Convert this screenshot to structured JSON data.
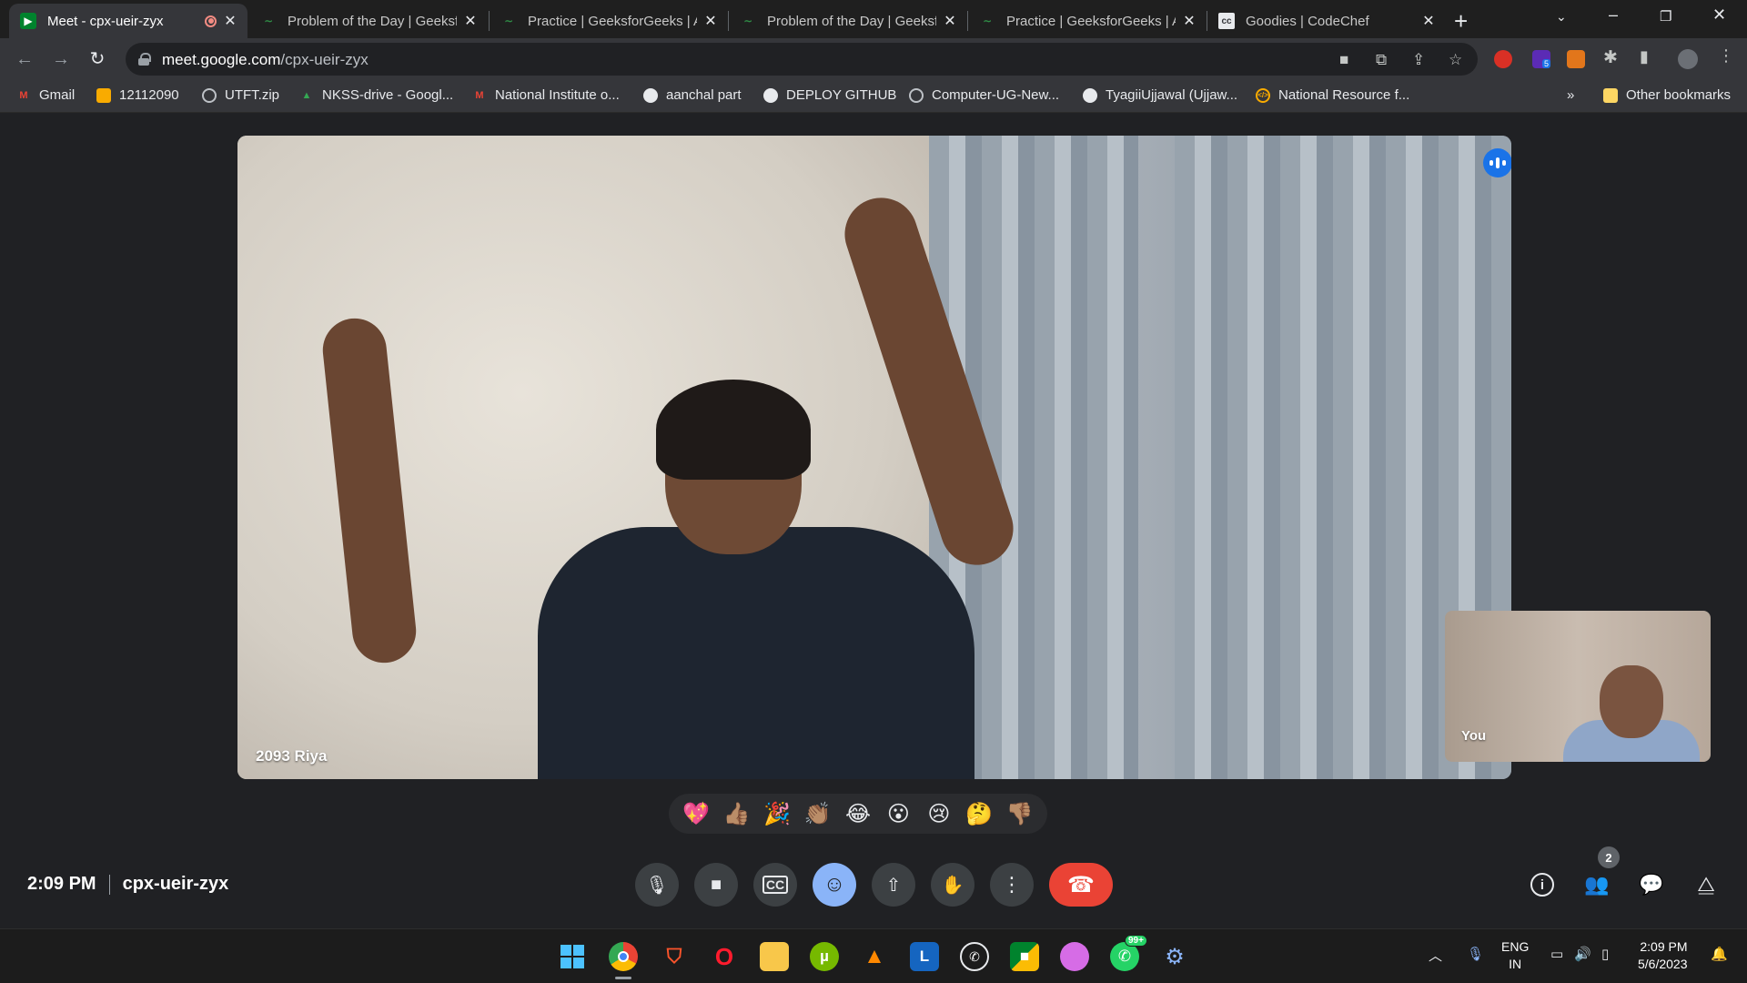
{
  "browser": {
    "tabs": [
      {
        "title": "Meet - cpx-ueir-zyx",
        "active": true,
        "recording": true
      },
      {
        "title": "Problem of the Day | GeeksforGeeks"
      },
      {
        "title": "Practice | GeeksforGeeks | A"
      },
      {
        "title": "Problem of the Day | GeeksforGeeks"
      },
      {
        "title": "Practice | GeeksforGeeks | A"
      },
      {
        "title": "Goodies | CodeChef"
      }
    ],
    "url_host": "meet.google.com",
    "url_path": "/cpx-ueir-zyx",
    "extension_badge": "5",
    "bookmarks": [
      {
        "label": "Gmail",
        "icon": "gmail-icon"
      },
      {
        "label": "12112090",
        "icon": "classroom-icon"
      },
      {
        "label": "UTFT.zip",
        "icon": "globe-icon"
      },
      {
        "label": "NKSS-drive - Googl...",
        "icon": "drive-icon"
      },
      {
        "label": "National Institute o...",
        "icon": "gmail-icon"
      },
      {
        "label": "aanchal part",
        "icon": "github-icon"
      },
      {
        "label": "DEPLOY GITHUB",
        "icon": "github-icon"
      },
      {
        "label": "Computer-UG-New...",
        "icon": "globe-icon"
      },
      {
        "label": "TyagiiUjjawal (Ujjaw...",
        "icon": "github-icon"
      },
      {
        "label": "National Resource f...",
        "icon": "code-icon"
      }
    ],
    "overflow_label": "»",
    "other_bookmarks": "Other bookmarks"
  },
  "meet": {
    "main_participant": "2093 Riya",
    "self_label": "You",
    "reactions": [
      "💖",
      "👍🏽",
      "🎉",
      "👏🏽",
      "😂",
      "😮",
      "😢",
      "🤔",
      "👎🏽"
    ],
    "time": "2:09 PM",
    "meeting_code": "cpx-ueir-zyx",
    "participant_count": "2"
  },
  "taskbar": {
    "lang_top": "ENG",
    "lang_bottom": "IN",
    "whatsapp_badge": "99+",
    "time": "2:09 PM",
    "date": "5/6/2023"
  },
  "colors": {
    "end_call": "#ea4335",
    "reactions_active": "#8ab4f8",
    "speaking_badge": "#1a73e8"
  }
}
